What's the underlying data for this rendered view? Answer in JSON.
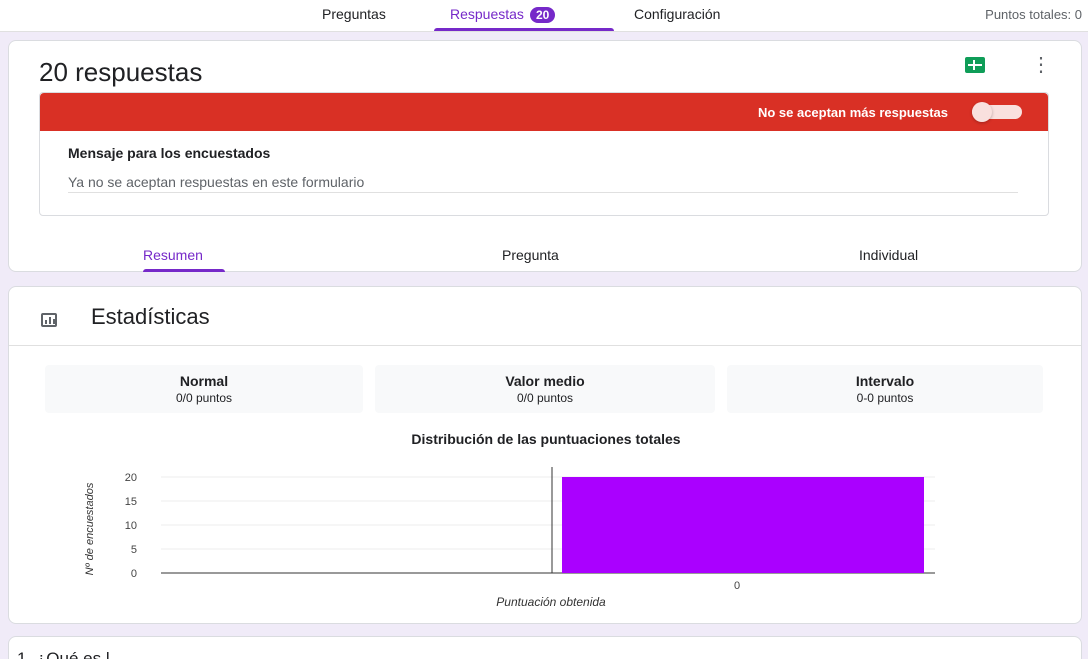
{
  "nav": {
    "tabs": [
      {
        "label": "Preguntas"
      },
      {
        "label": "Respuestas",
        "badge": "20"
      },
      {
        "label": "Configuración"
      }
    ],
    "total_points": "Puntos totales: 0"
  },
  "responses": {
    "title": "20 respuestas",
    "accepting_label": "No se aceptan más respuestas",
    "accepting": false,
    "message_label": "Mensaje para los encuestados",
    "message_value": "Ya no se aceptan respuestas en este formulario",
    "view_tabs": [
      {
        "label": "Resumen"
      },
      {
        "label": "Pregunta"
      },
      {
        "label": "Individual"
      }
    ]
  },
  "stats": {
    "title": "Estadísticas",
    "metrics": [
      {
        "label": "Normal",
        "value": "0/0 puntos"
      },
      {
        "label": "Valor medio",
        "value": "0/0 puntos"
      },
      {
        "label": "Intervalo",
        "value": "0-0 puntos"
      }
    ]
  },
  "chart_data": {
    "type": "bar",
    "title": "Distribución de las puntuaciones totales",
    "xlabel": "Puntuación obtenida",
    "ylabel": "Nº de encuestados",
    "categories": [
      "0"
    ],
    "values": [
      20
    ],
    "yticks": [
      "0",
      "5",
      "10",
      "15",
      "20"
    ],
    "ylim": [
      0,
      20
    ],
    "bar_color": "#aa00ff",
    "grid": true
  },
  "next_card": {
    "question_text": "1. ¿Qué es l…"
  },
  "colors": {
    "accent": "#7629c9",
    "banner": "#d93025",
    "background": "#f0ebf8"
  }
}
